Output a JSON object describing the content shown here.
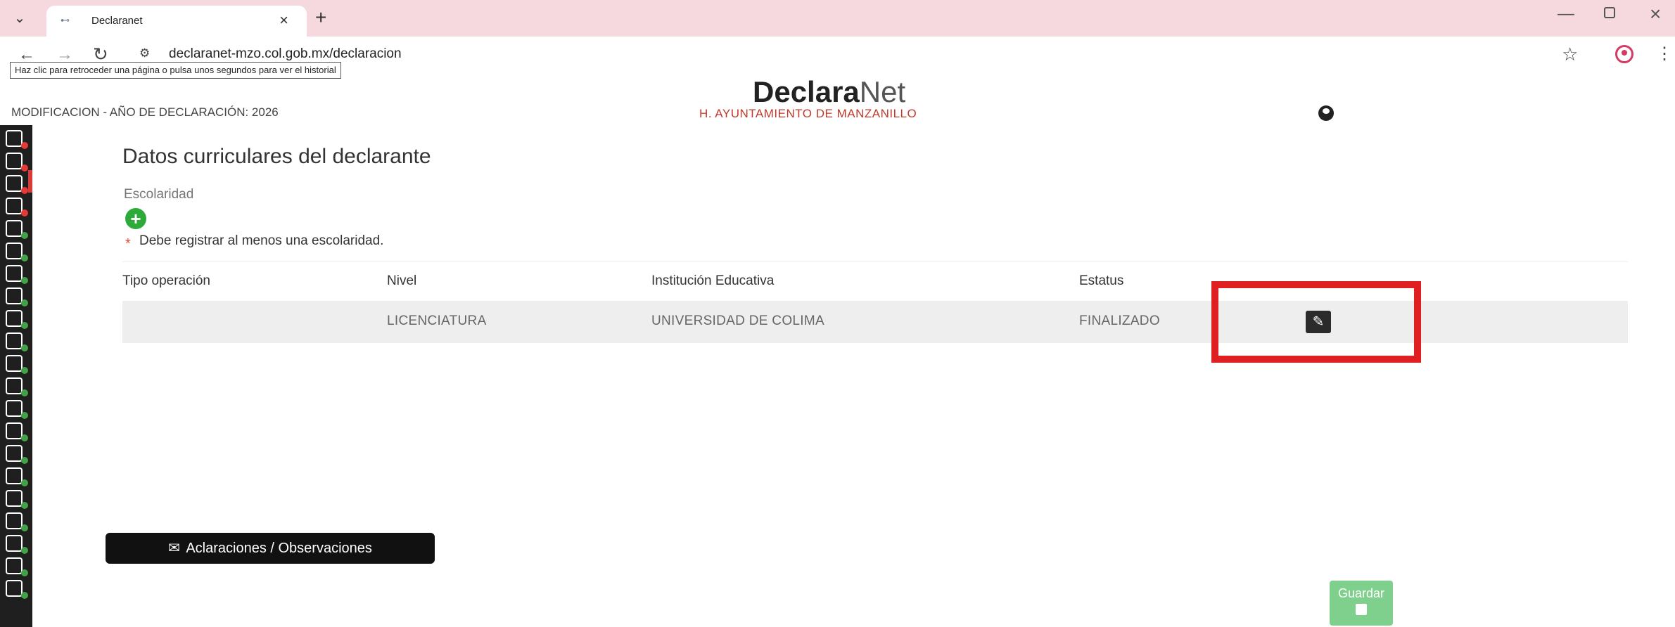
{
  "browser": {
    "tab_title": "Declaranet",
    "tab_close": "×",
    "new_tab": "+",
    "url": "declaranet-mzo.col.gob.mx/declaracion",
    "tooltip": "Haz clic para retroceder una página o pulsa unos segundos para ver el historial",
    "icons": {
      "tab_menu": "chevron-down-icon",
      "back": "back-arrow-icon",
      "forward": "forward-arrow-icon",
      "reload": "reload-icon",
      "site_info": "site-info-icon",
      "star": "star-icon",
      "profile": "profile-icon",
      "menu": "kebab-menu-icon"
    }
  },
  "header": {
    "brand_bold": "Declara",
    "brand_light": "Net",
    "subtitle": "H. AYUNTAMIENTO DE MANZANILLO",
    "declaration_info": "MODIFICACION - AÑO DE DECLARACIÓN: 2026"
  },
  "sidebar": {
    "items": [
      {
        "icon": "id-card-icon",
        "status": "red"
      },
      {
        "icon": "home-icon",
        "status": "red"
      },
      {
        "icon": "document-icon",
        "status": "red"
      },
      {
        "icon": "building-icon",
        "status": "red"
      },
      {
        "icon": "people-icon",
        "status": "green"
      },
      {
        "icon": "family-icon",
        "status": "green"
      },
      {
        "icon": "form-icon",
        "status": "green"
      },
      {
        "icon": "money-icon",
        "status": "green"
      },
      {
        "icon": "house-icon",
        "status": "green"
      },
      {
        "icon": "car-icon",
        "status": "green"
      },
      {
        "icon": "chart-icon",
        "status": "green"
      },
      {
        "icon": "investment-icon",
        "status": "green"
      },
      {
        "icon": "loan-icon",
        "status": "green"
      },
      {
        "icon": "property-icon",
        "status": "green"
      },
      {
        "icon": "pie-icon",
        "status": "green"
      },
      {
        "icon": "org-icon",
        "status": "green"
      },
      {
        "icon": "group-icon",
        "status": "green"
      },
      {
        "icon": "community-icon",
        "status": "green"
      },
      {
        "icon": "board-icon",
        "status": "green"
      },
      {
        "icon": "person-group-icon",
        "status": "green"
      },
      {
        "icon": "table-icon",
        "status": "green"
      }
    ],
    "colors": {
      "red": "#e53935",
      "green": "#43a047"
    }
  },
  "main": {
    "title": "Datos curriculares del declarante",
    "field_label": "Escolaridad",
    "add_symbol": "+",
    "required_star": "*",
    "required_message": "Debe registrar al menos una escolaridad.",
    "table": {
      "headers": [
        "Tipo operación",
        "Nivel",
        "Institución Educativa",
        "Estatus"
      ],
      "rows": [
        {
          "tipo": "",
          "nivel": "LICENCIATURA",
          "institucion": "UNIVERSIDAD DE COLIMA",
          "estatus": "FINALIZADO"
        }
      ]
    },
    "observations_button": "Aclaraciones / Observaciones",
    "save_button": "Guardar"
  }
}
